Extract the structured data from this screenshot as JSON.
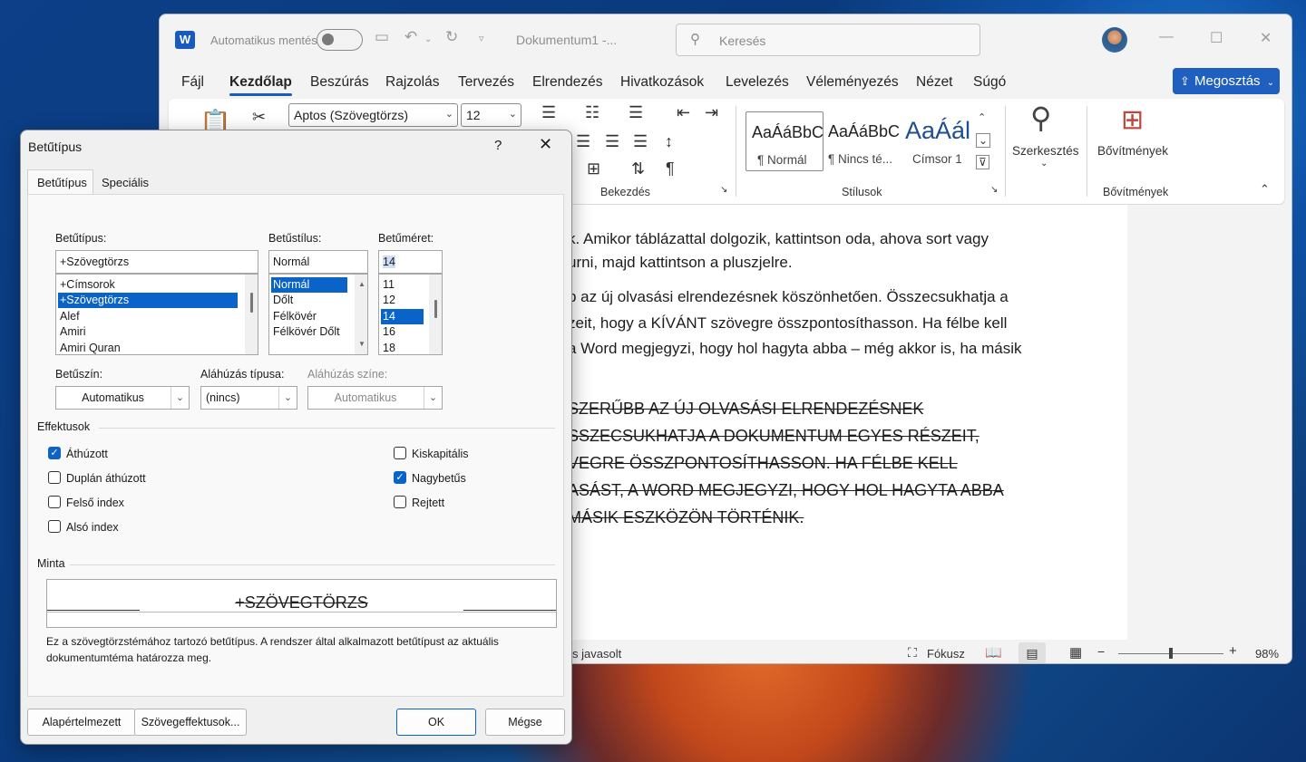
{
  "window": {
    "autosave_label": "Automatikus mentés",
    "doc_title": "Dokumentum1  -...",
    "search_placeholder": "Keresés"
  },
  "menu": [
    "Fájl",
    "Kezdőlap",
    "Beszúrás",
    "Rajzolás",
    "Tervezés",
    "Elrendezés",
    "Hivatkozások",
    "Levelezés",
    "Véleményezés",
    "Nézet",
    "Súgó"
  ],
  "share_label": "Megosztás",
  "ribbon": {
    "font_name": "Aptos (Szövegtörzs)",
    "font_size": "12",
    "group_paragraph": "Bekezdés",
    "group_styles": "Stílusok",
    "group_addins": "Bővítmények",
    "styles": [
      {
        "preview": "AaÁáBbC",
        "name": "¶ Normál"
      },
      {
        "preview": "AaÁáBbC",
        "name": "¶ Nincs té..."
      },
      {
        "preview": "AaÁál",
        "name": "Címsor 1"
      }
    ],
    "editing_label": "Szerkesztés",
    "addins_label": "Bővítmények"
  },
  "document": {
    "lines": [
      {
        "text": "k. Amikor táblázattal dolgozik, kattintson oda, ahova sort vagy",
        "strike": false
      },
      {
        "text": "urni, majd kattintson a pluszjelre.",
        "strike": false
      },
      {
        "text": "b az új olvasási elrendezésnek köszönhetően. Összecsukhatja a",
        "strike": false
      },
      {
        "text": "zeit, hogy a KÍVÁNT szövegre összpontosíthasson. Ha félbe kell",
        "strike": false
      },
      {
        "text": "a Word megjegyzi, hogy hol hagyta abba – még akkor is, ha másik",
        "strike": false
      },
      {
        "text": "SZERŰBB AZ ÚJ OLVASÁSI ELRENDEZÉSNEK",
        "strike": true
      },
      {
        "text": "SSZECSUKHATJA A DOKUMENTUM EGYES RÉSZEIT,",
        "strike": true
      },
      {
        "text": "VEGRE ÖSSZPONTOSÍTHASSON. HA FÉLBE KELL",
        "strike": true
      },
      {
        "text": "ASÁST, A WORD MEGJEGYZI, HOGY HOL HAGYTA ABBA",
        "strike": true
      },
      {
        "text": "MÁSIK ESZKÖZÖN TÖRTÉNIK.",
        "strike": true
      }
    ]
  },
  "status": {
    "suggest": "s javasolt",
    "focus": "Fókusz",
    "zoom": "98%",
    "zoom_fraction": 0.5
  },
  "dialog": {
    "title": "Betűtípus",
    "help": "?",
    "tabs": [
      "Betűtípus",
      "Speciális"
    ],
    "font_label": "Betűtípus:",
    "font_value": "+Szövegtörzs",
    "font_list": [
      "+Címsorok",
      "+Szövegtörzs",
      "Alef",
      "Amiri",
      "Amiri Quran"
    ],
    "style_label": "Betűstílus:",
    "style_value": "Normál",
    "style_list": [
      "Normál",
      "Dőlt",
      "Félkövér",
      "Félkövér Dőlt"
    ],
    "size_label": "Betűméret:",
    "size_value": "14",
    "size_list": [
      "11",
      "12",
      "14",
      "16",
      "18"
    ],
    "color_label": "Betűszín:",
    "color_value": "Automatikus",
    "underline_label": "Aláhúzás típusa:",
    "underline_value": "(nincs)",
    "underline_color_label": "Aláhúzás színe:",
    "underline_color_value": "Automatikus",
    "effects_label": "Effektusok",
    "effects_left": [
      {
        "label": "Áthúzott",
        "checked": true
      },
      {
        "label": "Duplán áthúzott",
        "checked": false
      },
      {
        "label": "Felső index",
        "checked": false
      },
      {
        "label": "Alsó index",
        "checked": false
      }
    ],
    "effects_right": [
      {
        "label": "Kiskapitális",
        "checked": false
      },
      {
        "label": "Nagybetűs",
        "checked": true
      },
      {
        "label": "Rejtett",
        "checked": false
      }
    ],
    "preview_label": "Minta",
    "preview_text": "+SZÖVEGTÖRZS",
    "description": "Ez a szövegtörzstémához tartozó betűtípus. A rendszer által alkalmazott betűtípust az aktuális",
    "description2": "dokumentumtéma határozza meg.",
    "btn_default": "Alapértelmezett",
    "btn_effects": "Szövegeffektusok...",
    "btn_ok": "OK",
    "btn_cancel": "Mégse"
  }
}
